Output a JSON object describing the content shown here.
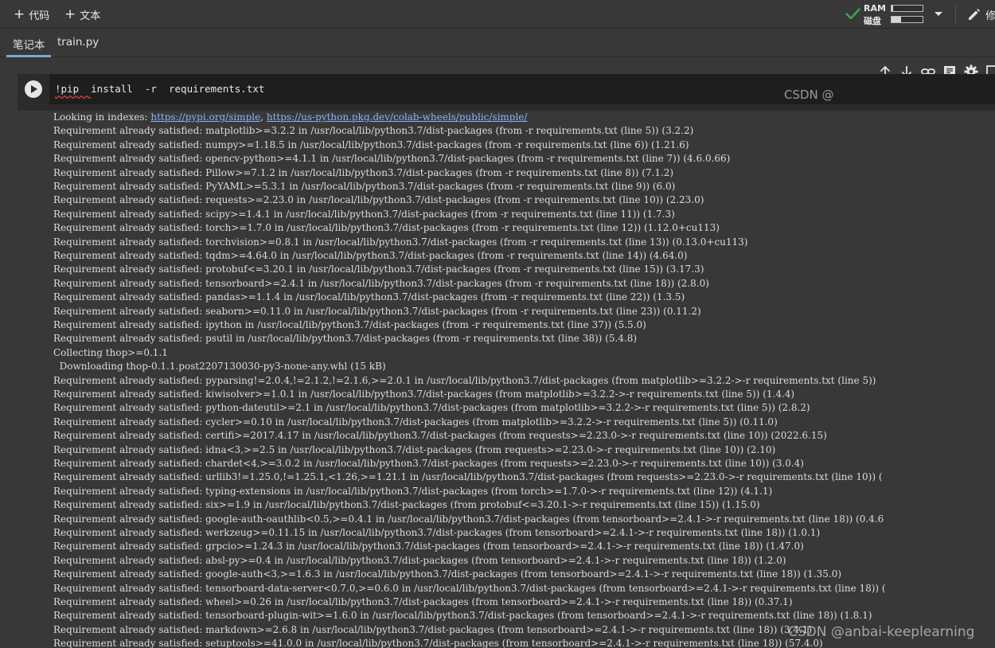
{
  "toolbar": {
    "code_label": "代码",
    "text_label": "文本",
    "ram_label": "RAM",
    "disk_label": "磁盘",
    "ram_usage": 0.05,
    "disk_usage": 0.3,
    "edit_label": "修"
  },
  "tabs": [
    {
      "label": "笔记本",
      "active": true
    },
    {
      "label": "train.py",
      "active": false
    }
  ],
  "cell": {
    "code": "install  -r  requirements.txt",
    "code_prefix": "!pip  "
  },
  "output": {
    "index_prefix": "Looking in indexes: ",
    "index_url1": "https://pypi.org/simple",
    "index_sep": ", ",
    "index_url2": "https://us-python.pkg.dev/colab-wheels/public/simple/",
    "lines": [
      "Requirement already satisfied: matplotlib>=3.2.2 in /usr/local/lib/python3.7/dist-packages (from -r requirements.txt (line 5)) (3.2.2)",
      "Requirement already satisfied: numpy>=1.18.5 in /usr/local/lib/python3.7/dist-packages (from -r requirements.txt (line 6)) (1.21.6)",
      "Requirement already satisfied: opencv-python>=4.1.1 in /usr/local/lib/python3.7/dist-packages (from -r requirements.txt (line 7)) (4.6.0.66)",
      "Requirement already satisfied: Pillow>=7.1.2 in /usr/local/lib/python3.7/dist-packages (from -r requirements.txt (line 8)) (7.1.2)",
      "Requirement already satisfied: PyYAML>=5.3.1 in /usr/local/lib/python3.7/dist-packages (from -r requirements.txt (line 9)) (6.0)",
      "Requirement already satisfied: requests>=2.23.0 in /usr/local/lib/python3.7/dist-packages (from -r requirements.txt (line 10)) (2.23.0)",
      "Requirement already satisfied: scipy>=1.4.1 in /usr/local/lib/python3.7/dist-packages (from -r requirements.txt (line 11)) (1.7.3)",
      "Requirement already satisfied: torch>=1.7.0 in /usr/local/lib/python3.7/dist-packages (from -r requirements.txt (line 12)) (1.12.0+cu113)",
      "Requirement already satisfied: torchvision>=0.8.1 in /usr/local/lib/python3.7/dist-packages (from -r requirements.txt (line 13)) (0.13.0+cu113)",
      "Requirement already satisfied: tqdm>=4.64.0 in /usr/local/lib/python3.7/dist-packages (from -r requirements.txt (line 14)) (4.64.0)",
      "Requirement already satisfied: protobuf<=3.20.1 in /usr/local/lib/python3.7/dist-packages (from -r requirements.txt (line 15)) (3.17.3)",
      "Requirement already satisfied: tensorboard>=2.4.1 in /usr/local/lib/python3.7/dist-packages (from -r requirements.txt (line 18)) (2.8.0)",
      "Requirement already satisfied: pandas>=1.1.4 in /usr/local/lib/python3.7/dist-packages (from -r requirements.txt (line 22)) (1.3.5)",
      "Requirement already satisfied: seaborn>=0.11.0 in /usr/local/lib/python3.7/dist-packages (from -r requirements.txt (line 23)) (0.11.2)",
      "Requirement already satisfied: ipython in /usr/local/lib/python3.7/dist-packages (from -r requirements.txt (line 37)) (5.5.0)",
      "Requirement already satisfied: psutil in /usr/local/lib/python3.7/dist-packages (from -r requirements.txt (line 38)) (5.4.8)",
      "Collecting thop>=0.1.1",
      "  Downloading thop-0.1.1.post2207130030-py3-none-any.whl (15 kB)",
      "Requirement already satisfied: pyparsing!=2.0.4,!=2.1.2,!=2.1.6,>=2.0.1 in /usr/local/lib/python3.7/dist-packages (from matplotlib>=3.2.2->-r requirements.txt (line 5))",
      "Requirement already satisfied: kiwisolver>=1.0.1 in /usr/local/lib/python3.7/dist-packages (from matplotlib>=3.2.2->-r requirements.txt (line 5)) (1.4.4)",
      "Requirement already satisfied: python-dateutil>=2.1 in /usr/local/lib/python3.7/dist-packages (from matplotlib>=3.2.2->-r requirements.txt (line 5)) (2.8.2)",
      "Requirement already satisfied: cycler>=0.10 in /usr/local/lib/python3.7/dist-packages (from matplotlib>=3.2.2->-r requirements.txt (line 5)) (0.11.0)",
      "Requirement already satisfied: certifi>=2017.4.17 in /usr/local/lib/python3.7/dist-packages (from requests>=2.23.0->-r requirements.txt (line 10)) (2022.6.15)",
      "Requirement already satisfied: idna<3,>=2.5 in /usr/local/lib/python3.7/dist-packages (from requests>=2.23.0->-r requirements.txt (line 10)) (2.10)",
      "Requirement already satisfied: chardet<4,>=3.0.2 in /usr/local/lib/python3.7/dist-packages (from requests>=2.23.0->-r requirements.txt (line 10)) (3.0.4)",
      "Requirement already satisfied: urllib3!=1.25.0,!=1.25.1,<1.26,>=1.21.1 in /usr/local/lib/python3.7/dist-packages (from requests>=2.23.0->-r requirements.txt (line 10)) (",
      "Requirement already satisfied: typing-extensions in /usr/local/lib/python3.7/dist-packages (from torch>=1.7.0->-r requirements.txt (line 12)) (4.1.1)",
      "Requirement already satisfied: six>=1.9 in /usr/local/lib/python3.7/dist-packages (from protobuf<=3.20.1->-r requirements.txt (line 15)) (1.15.0)",
      "Requirement already satisfied: google-auth-oauthlib<0.5,>=0.4.1 in /usr/local/lib/python3.7/dist-packages (from tensorboard>=2.4.1->-r requirements.txt (line 18)) (0.4.6",
      "Requirement already satisfied: werkzeug>=0.11.15 in /usr/local/lib/python3.7/dist-packages (from tensorboard>=2.4.1->-r requirements.txt (line 18)) (1.0.1)",
      "Requirement already satisfied: grpcio>=1.24.3 in /usr/local/lib/python3.7/dist-packages (from tensorboard>=2.4.1->-r requirements.txt (line 18)) (1.47.0)",
      "Requirement already satisfied: absl-py>=0.4 in /usr/local/lib/python3.7/dist-packages (from tensorboard>=2.4.1->-r requirements.txt (line 18)) (1.2.0)",
      "Requirement already satisfied: google-auth<3,>=1.6.3 in /usr/local/lib/python3.7/dist-packages (from tensorboard>=2.4.1->-r requirements.txt (line 18)) (1.35.0)",
      "Requirement already satisfied: tensorboard-data-server<0.7.0,>=0.6.0 in /usr/local/lib/python3.7/dist-packages (from tensorboard>=2.4.1->-r requirements.txt (line 18)) (",
      "Requirement already satisfied: wheel>=0.26 in /usr/local/lib/python3.7/dist-packages (from tensorboard>=2.4.1->-r requirements.txt (line 18)) (0.37.1)",
      "Requirement already satisfied: tensorboard-plugin-wit>=1.6.0 in /usr/local/lib/python3.7/dist-packages (from tensorboard>=2.4.1->-r requirements.txt (line 18)) (1.8.1)",
      "Requirement already satisfied: markdown>=2.6.8 in /usr/local/lib/python3.7/dist-packages (from tensorboard>=2.4.1->-r requirements.txt (line 18)) (3.4.1)",
      "Requirement already satisfied: setuptools>=41.0.0 in /usr/local/lib/python3.7/dist-packages (from tensorboard>=2.4.1->-r requirements.txt (line 18)) (57.4.0)"
    ]
  },
  "watermark": "CSDN @anbai-keeplearning",
  "colors": {
    "background": "#383838",
    "code_bg": "#1e1e1e",
    "link": "#8ab4f8",
    "tab_underline": "#7ba7d9",
    "check": "#34a853"
  }
}
